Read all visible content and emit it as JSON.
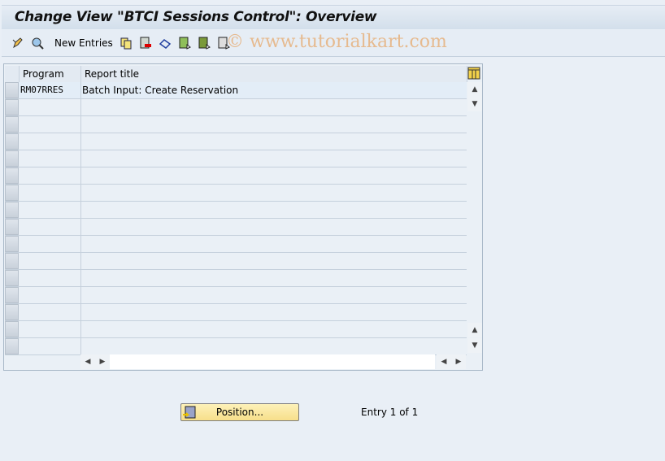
{
  "title": "Change View \"BTCI Sessions Control\": Overview",
  "toolbar": {
    "new_entries": "New Entries",
    "watermark": "© www.tutorialkart.com",
    "icons": [
      "display-change-icon",
      "find-icon",
      "copy-icon",
      "delete-icon",
      "undo-icon",
      "select-all-icon",
      "select-block-icon",
      "deselect-all-icon"
    ]
  },
  "table": {
    "columns": [
      "Program",
      "Report title"
    ],
    "rows": [
      {
        "program": "RM07RRES",
        "title": "Batch Input: Create Reservation"
      }
    ],
    "empty_rows": 15
  },
  "footer": {
    "position_button": "Position...",
    "entry_info": "Entry 1 of 1"
  }
}
